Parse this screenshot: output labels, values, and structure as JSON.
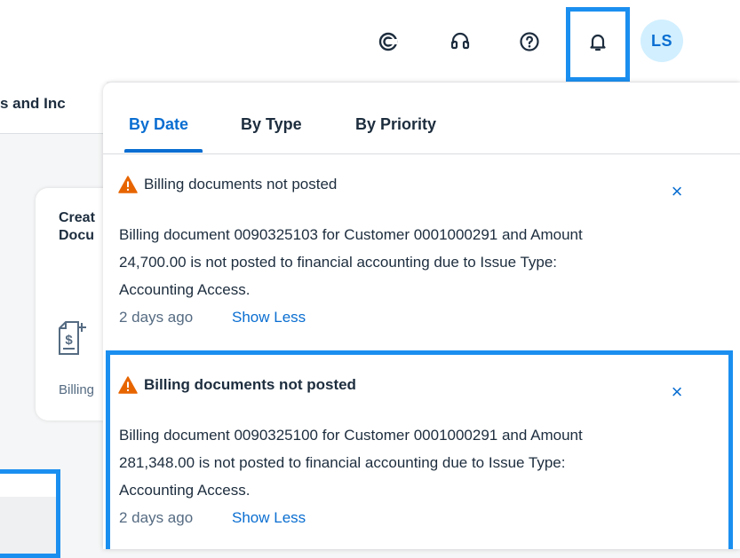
{
  "shellbar": {
    "icons": [
      "copilot-icon",
      "headset-icon",
      "help-icon",
      "bell-icon"
    ],
    "avatar_initials": "LS"
  },
  "background": {
    "tab_text": "s and Inc",
    "tile_title": "Creat\nDocu",
    "tile_subtitle": "Billing"
  },
  "popover": {
    "tabs": [
      {
        "label": "By Date",
        "selected": true
      },
      {
        "label": "By Type",
        "selected": false
      },
      {
        "label": "By Priority",
        "selected": false
      }
    ],
    "notifications": [
      {
        "title": "Billing documents not posted",
        "unread": false,
        "body": "Billing document 0090325103 for Customer 0001000291 and Amount 24,700.00 is not posted to financial accounting due to Issue Type: Accounting Access.",
        "time": "2 days ago",
        "toggle_label": "Show Less",
        "close_icon": "×"
      },
      {
        "title": "Billing documents not posted",
        "unread": true,
        "body": "Billing document 0090325100 for Customer 0001000291 and Amount 281,348.00 is not posted to financial accounting due to Issue Type: Accounting Access.",
        "time": "2 days ago",
        "toggle_label": "Show Less",
        "close_icon": "×"
      }
    ]
  },
  "colors": {
    "accent": "#0a6ed1",
    "highlight": "#1b8ff0",
    "warning": "#e76500"
  }
}
